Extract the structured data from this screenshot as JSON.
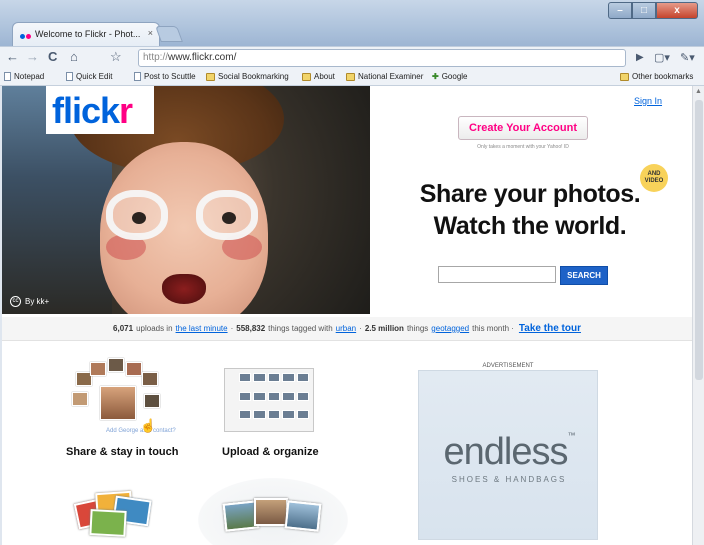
{
  "browser": {
    "tab_title": "Welcome to Flickr - Phot...",
    "tab_close": "×",
    "url_protocol": "http://",
    "url_host": "www.flickr.com/",
    "window_buttons": {
      "minimize": "–",
      "maximize": "□",
      "close": "x"
    }
  },
  "bookmarks": [
    {
      "label": "Notepad",
      "icon": "page-icon"
    },
    {
      "label": "Quick Edit",
      "icon": "page-icon"
    },
    {
      "label": "Post to Scuttle",
      "icon": "page-icon"
    },
    {
      "label": "Social Bookmarking",
      "icon": "folder-icon"
    },
    {
      "label": "About",
      "icon": "folder-icon"
    },
    {
      "label": "National Examiner",
      "icon": "folder-icon"
    },
    {
      "label": "Google",
      "icon": "google-icon"
    }
  ],
  "other_bookmarks": "Other bookmarks",
  "page": {
    "logo_part1": "flick",
    "logo_part2": "r",
    "photo_credit": "By kk+",
    "signin": "Sign In",
    "create_account": "Create Your Account",
    "create_note": "Only takes a moment with your Yahoo! ID",
    "headline_line1": "Share your photos.",
    "headline_line2": "Watch the world.",
    "badge": "AND VIDEO",
    "search_button": "SEARCH",
    "stats": {
      "uploads": "6,071",
      "uploads_text": "uploads in",
      "last_minute": "the last minute",
      "sep1": "·",
      "tagged_count": "558,832",
      "tagged_text": "things tagged with",
      "tag": "urban",
      "sep2": "·",
      "geo_count": "2.5 million",
      "geo_text": "things",
      "geotagged": "geotagged",
      "geo_tail": "this month ·",
      "tour": "Take the tour"
    },
    "feature1_label": "Share & stay in touch",
    "feature1_link": "Add George as a contact?",
    "feature2_label": "Upload & organize",
    "ad_label": "ADVERTISEMENT",
    "ad_brand": "endless",
    "ad_tm": "™",
    "ad_tagline": "SHOES & HANDBAGS"
  },
  "colors": {
    "flickr_blue": "#0063dc",
    "flickr_pink": "#ff0084",
    "search_blue": "#1e62c7"
  }
}
